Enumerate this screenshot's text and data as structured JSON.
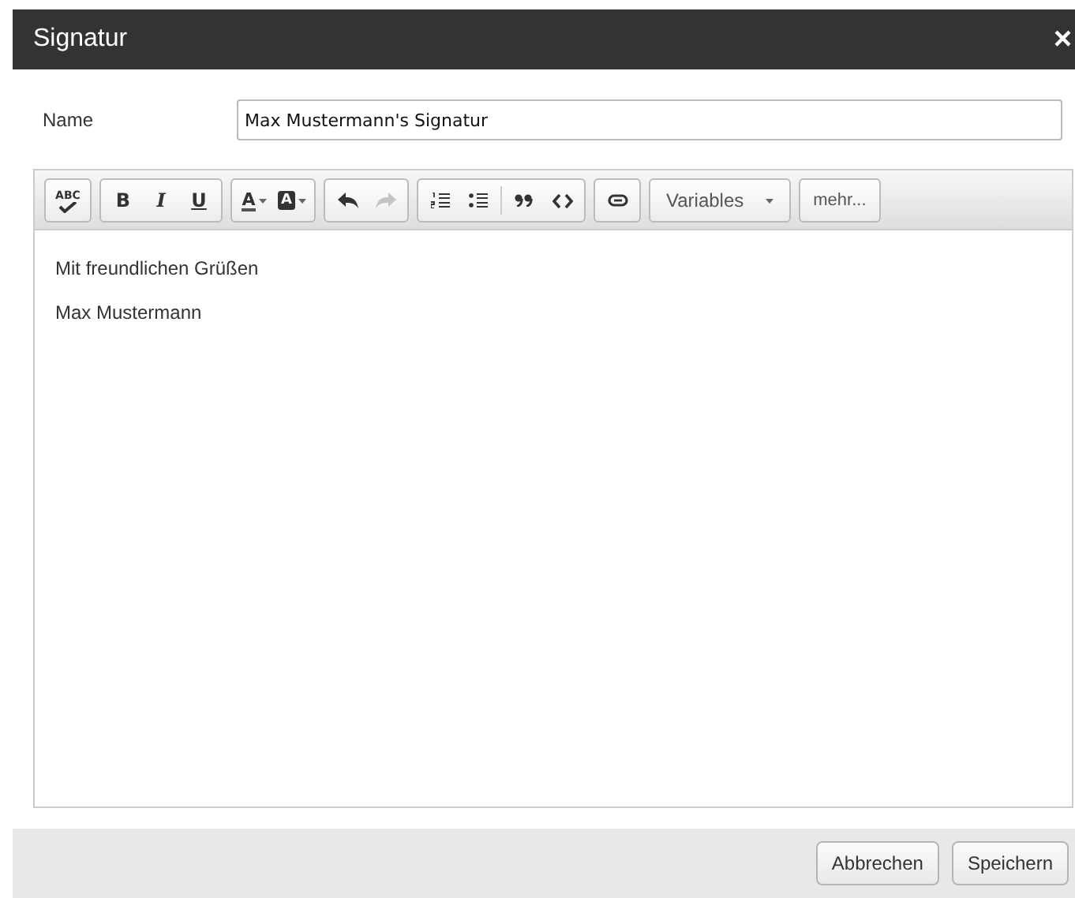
{
  "window": {
    "title": "Signatur",
    "close": "×"
  },
  "name_field": {
    "label": "Name",
    "value": "Max Mustermann's Signatur"
  },
  "toolbar": {
    "groups": [
      [
        {
          "kind": "spellcheck",
          "label": "ABC"
        }
      ],
      [
        {
          "kind": "bold",
          "label": "B"
        },
        {
          "kind": "italic",
          "label": "I"
        },
        {
          "kind": "underline",
          "label": "U"
        }
      ],
      [
        {
          "kind": "forecolor",
          "label": "A"
        },
        {
          "kind": "backcolor",
          "label": "A"
        }
      ],
      [
        {
          "kind": "undo",
          "disabled": false
        },
        {
          "kind": "redo",
          "disabled": true
        }
      ],
      [
        {
          "kind": "ol"
        },
        {
          "kind": "ul"
        },
        {
          "kind": "separator"
        },
        {
          "kind": "quote"
        },
        {
          "kind": "code"
        }
      ],
      [
        {
          "kind": "link"
        }
      ],
      [
        {
          "kind": "dropdown",
          "label": "Variables"
        }
      ],
      [
        {
          "kind": "text",
          "label": "mehr..."
        }
      ]
    ]
  },
  "editor": {
    "paragraphs": [
      "Mit freundlichen Grüßen",
      "Max Mustermann"
    ]
  },
  "buttons": [
    "Abbrechen",
    "Speichern"
  ]
}
